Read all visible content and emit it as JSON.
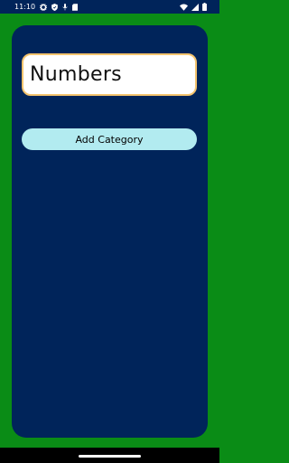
{
  "status_bar": {
    "time": "11:10",
    "left_icons": [
      "settings-icon",
      "shield-icon",
      "mic-icon",
      "sd-card-icon"
    ],
    "right_icons": [
      "wifi-icon",
      "cell-signal-icon",
      "battery-icon"
    ]
  },
  "form": {
    "category_input_value": "Numbers",
    "add_button_label": "Add Category"
  },
  "colors": {
    "background": "#0a8c16",
    "card": "#00245a",
    "input_border": "#f4c46e",
    "button": "#b2ebf0"
  }
}
